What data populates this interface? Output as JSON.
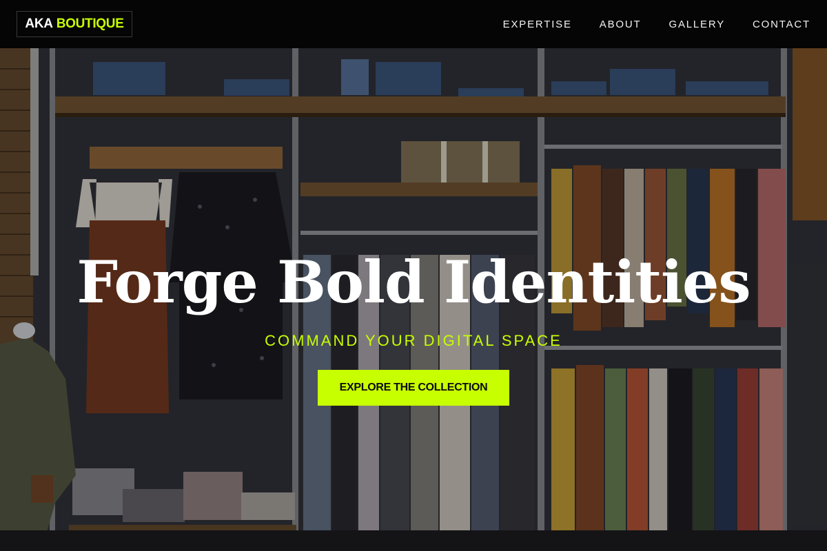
{
  "brand": {
    "part1": "AKA",
    "part2": "BOUTIQUE",
    "accent_color": "#c8ff00"
  },
  "nav": {
    "items": [
      "EXPERTISE",
      "ABOUT",
      "GALLERY",
      "CONTACT"
    ]
  },
  "hero": {
    "title": "Forge Bold Identities",
    "subtitle": "COMMAND YOUR DIGITAL SPACE",
    "cta_label": "EXPLORE THE COLLECTION",
    "background_image": "boutique-clothing-rack-photo"
  }
}
